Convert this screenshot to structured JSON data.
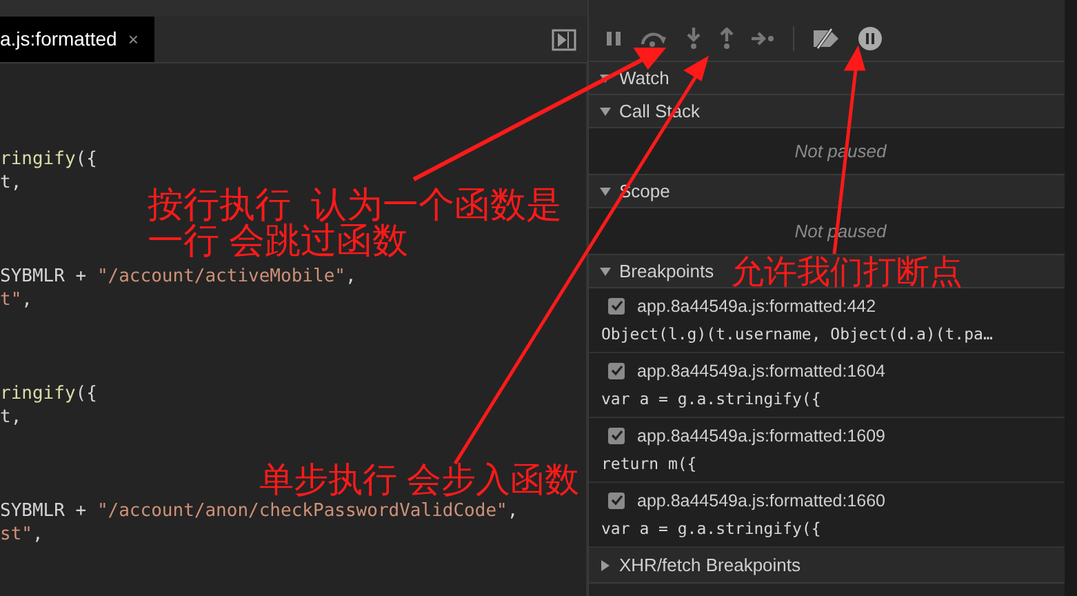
{
  "editor": {
    "tab": {
      "label": "a.js:formatted",
      "close": "×",
      "selected": true
    },
    "blocks": [
      [
        [
          {
            "kind": "fn",
            "text": "ringify"
          },
          {
            "kind": "plain",
            "text": "({"
          }
        ],
        [
          {
            "kind": "plain",
            "text": "t,"
          }
        ]
      ],
      [
        [
          {
            "kind": "plain",
            "text": "SYBMLR + "
          },
          {
            "kind": "string",
            "text": "\"/account/activeMobile\""
          },
          {
            "kind": "plain",
            "text": ","
          }
        ],
        [
          {
            "kind": "string",
            "text": "t\""
          },
          {
            "kind": "plain",
            "text": ","
          }
        ]
      ],
      [
        [
          {
            "kind": "fn",
            "text": "ringify"
          },
          {
            "kind": "plain",
            "text": "({"
          }
        ],
        [
          {
            "kind": "plain",
            "text": "t,"
          }
        ]
      ],
      [
        [
          {
            "kind": "plain",
            "text": "SYBMLR + "
          },
          {
            "kind": "string",
            "text": "\"/account/anon/checkPasswordValidCode\""
          },
          {
            "kind": "plain",
            "text": ","
          }
        ],
        [
          {
            "kind": "string",
            "text": "st\""
          },
          {
            "kind": "plain",
            "text": ","
          }
        ]
      ]
    ]
  },
  "debugger": {
    "sections": [
      {
        "title": "Watch",
        "expanded": true
      },
      {
        "title": "Call Stack",
        "expanded": true,
        "empty_text": "Not paused"
      },
      {
        "title": "Scope",
        "expanded": true,
        "empty_text": "Not paused"
      }
    ],
    "breakpoints": {
      "title": "Breakpoints",
      "expanded": true,
      "items": [
        {
          "location": "app.8a44549a.js:formatted:442",
          "code": "Object(l.g)(t.username, Object(d.a)(t.pa…",
          "checked": true
        },
        {
          "location": "app.8a44549a.js:formatted:1604",
          "code": "var a = g.a.stringify({",
          "checked": true
        },
        {
          "location": "app.8a44549a.js:formatted:1609",
          "code": "return m({",
          "checked": true
        },
        {
          "location": "app.8a44549a.js:formatted:1660",
          "code": "var a = g.a.stringify({",
          "checked": true
        }
      ]
    },
    "xhr": {
      "title": "XHR/fetch Breakpoints",
      "expanded": false
    }
  },
  "annotations": [
    {
      "lines": [
        "按行执行  认为一个函数是",
        "一行 会跳过函数"
      ]
    },
    {
      "lines": [
        "允许我们打断点"
      ]
    },
    {
      "lines": [
        "单步执行 会步入函数"
      ]
    }
  ]
}
